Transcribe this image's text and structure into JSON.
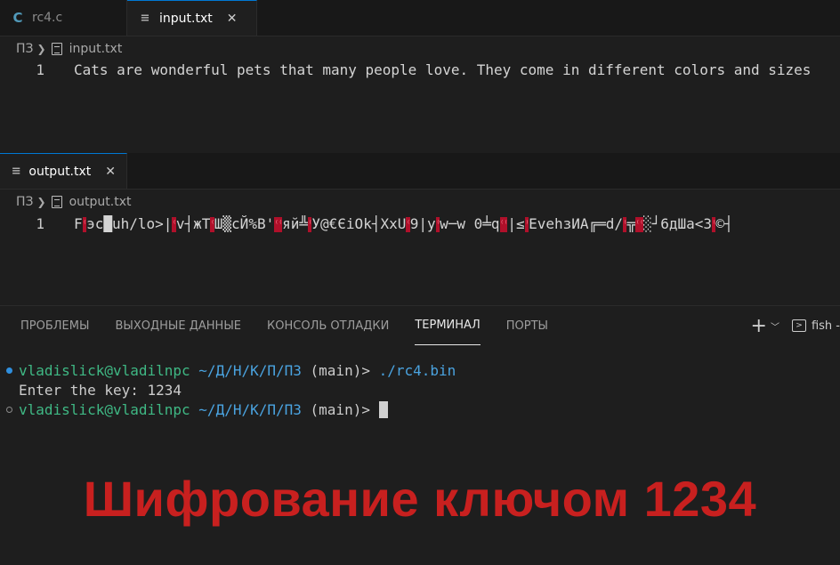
{
  "editor_top": {
    "tabs": [
      {
        "label": "rc4.c",
        "icon": "c-file-icon",
        "active": false
      },
      {
        "label": "input.txt",
        "icon": "text-file-icon",
        "active": true
      }
    ],
    "breadcrumb": {
      "folder": "ПЗ",
      "file": "input.txt"
    },
    "line_number": "1",
    "line_text": "Cats are wonderful pets that many people love. They come in different colors and sizes"
  },
  "editor_bottom": {
    "tabs": [
      {
        "label": "output.txt",
        "icon": "text-file-icon",
        "active": true
      }
    ],
    "breadcrumb": {
      "folder": "ПЗ",
      "file": "output.txt"
    },
    "line_number": "1",
    "line_segments": [
      {
        "t": "F",
        "bad": false
      },
      {
        "t": "⁽",
        "bad": true
      },
      {
        "t": "эс",
        "bad": false
      },
      {
        "t": "█",
        "bad": false
      },
      {
        "t": "uh/lo>|",
        "bad": false
      },
      {
        "t": "⁽",
        "bad": true
      },
      {
        "t": "v┤жТ",
        "bad": false
      },
      {
        "t": "⁽",
        "bad": true
      },
      {
        "t": "Ш▒сЙ%В'",
        "bad": false
      },
      {
        "t": "⁽⁽",
        "bad": true
      },
      {
        "t": "яй╩",
        "bad": false
      },
      {
        "t": "⁽",
        "bad": true
      },
      {
        "t": "У@€ЄiOk┤XxU",
        "bad": false
      },
      {
        "t": "⁽",
        "bad": true
      },
      {
        "t": "9|y",
        "bad": false
      },
      {
        "t": "⁽",
        "bad": true
      },
      {
        "t": "w─w 0╧q",
        "bad": false
      },
      {
        "t": "⁽⁽",
        "bad": true
      },
      {
        "t": "|≤",
        "bad": false
      },
      {
        "t": "⁾",
        "bad": true
      },
      {
        "t": "EvehзИА╔═d/",
        "bad": false
      },
      {
        "t": "⁽",
        "bad": true
      },
      {
        "t": "╦",
        "bad": false
      },
      {
        "t": "⁽⁽",
        "bad": true
      },
      {
        "t": "░┘6дШа<3",
        "bad": false
      },
      {
        "t": "⁽",
        "bad": true
      },
      {
        "t": "©┤",
        "bad": false
      }
    ]
  },
  "panel": {
    "tabs": [
      "ПРОБЛЕМЫ",
      "ВЫХОДНЫЕ ДАННЫЕ",
      "КОНСОЛЬ ОТЛАДКИ",
      "ТЕРМИНАЛ",
      "ПОРТЫ"
    ],
    "active_tab": "ТЕРМИНАЛ",
    "terminal_name": "fish -"
  },
  "terminal": {
    "line1": {
      "user": "vladislick@vladilnpc",
      "path": "~/Д/Н/К/П/ПЗ",
      "branch": "(main)>",
      "cmd": "./rc4.bin"
    },
    "line2": "Enter the key: 1234",
    "line3": {
      "user": "vladislick@vladilnpc",
      "path": "~/Д/Н/К/П/ПЗ",
      "branch": "(main)>"
    }
  },
  "caption": "Шифрование ключом 1234",
  "colors": {
    "accent": "#0078d4",
    "caption": "#c8201f",
    "user": "#3fb884",
    "path": "#4aa3e0"
  }
}
